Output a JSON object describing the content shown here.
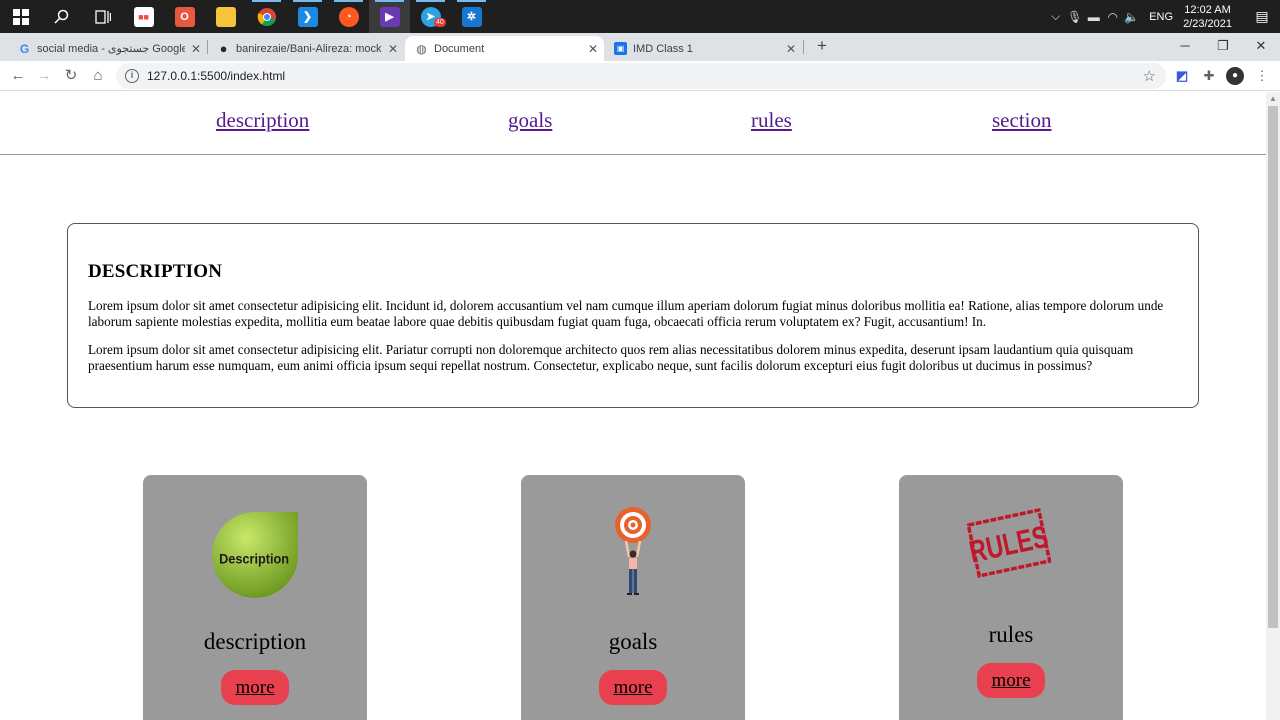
{
  "taskbar": {
    "apps": [
      {
        "name": "windows-start-icon",
        "color": "#ffffff"
      },
      {
        "name": "search-icon",
        "color": "#ffffff"
      },
      {
        "name": "task-view-icon",
        "color": "#ffffff"
      },
      {
        "name": "store-icon",
        "color": "#ffffff"
      },
      {
        "name": "office-icon",
        "color": "#e9573f"
      },
      {
        "name": "file-explorer-icon",
        "color": "#f7c33b"
      },
      {
        "name": "chrome-icon",
        "color": "#db4437"
      },
      {
        "name": "vscode-icon",
        "color": "#1e88e5"
      },
      {
        "name": "app-orange-icon",
        "color": "#ff5722"
      },
      {
        "name": "visual-studio-icon",
        "color": "#6a3ab2"
      },
      {
        "name": "telegram-icon",
        "color": "#2aa3df"
      },
      {
        "name": "app-blue-icon",
        "color": "#1976d2"
      }
    ],
    "telegram_badge": "40",
    "lang": "ENG",
    "time": "12:02 AM",
    "date": "2/23/2021"
  },
  "tabs": [
    {
      "title": "social media - جستجوی Google",
      "favicon": "G"
    },
    {
      "title": "banirezaie/Bani-Alireza: mock-ht",
      "favicon": "●"
    },
    {
      "title": "Document",
      "favicon": "◍"
    },
    {
      "title": "IMD Class 1",
      "favicon": "▣"
    }
  ],
  "address": {
    "url": "127.0.0.1:5500/index.html"
  },
  "site_nav": [
    "description",
    "goals",
    "rules",
    "section"
  ],
  "description": {
    "heading": "DESCRIPTION",
    "p1": "Lorem ipsum dolor sit amet consectetur adipisicing elit. Incidunt id, dolorem accusantium vel nam cumque illum aperiam dolorum fugiat minus doloribus mollitia ea! Ratione, alias tempore dolorum unde laborum sapiente molestias expedita, mollitia eum beatae labore quae debitis quibusdam fugiat quam fuga, obcaecati officia rerum voluptatem ex? Fugit, accusantium! In.",
    "p2": "Lorem ipsum dolor sit amet consectetur adipisicing elit. Pariatur corrupti non doloremque architecto quos rem alias necessitatibus dolorem minus expedita, deserunt ipsam laudantium quia quisquam praesentium harum esse numquam, eum animi officia ipsum sequi repellat nostrum. Consectetur, explicabo neque, sunt facilis dolorum excepturi eius fugit doloribus ut ducimus in possimus?"
  },
  "cards": [
    {
      "title": "description",
      "button": "more",
      "badge_text": "Description"
    },
    {
      "title": "goals",
      "button": "more"
    },
    {
      "title": "rules",
      "button": "more",
      "stamp_text": "RULES"
    }
  ]
}
